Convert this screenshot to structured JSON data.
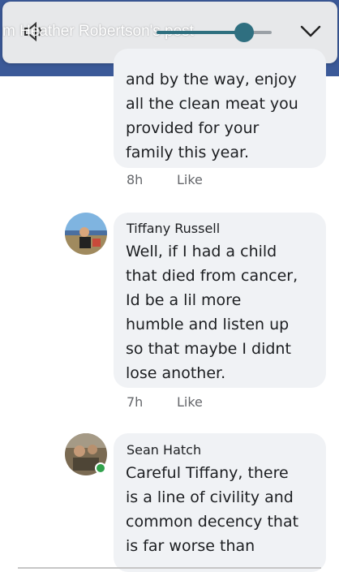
{
  "header": {
    "post_title": "m Heather Robertson's post",
    "volume_level": 0.73
  },
  "comments": [
    {
      "text": "and by the way, enjoy\nall the clean meat you\nprovided for your\nfamily this year.",
      "time": "8h",
      "like_label": "Like"
    },
    {
      "author": "Tiffany Russell",
      "text": "Well, if I had a child\nthat died from cancer,\nId be a lil more\nhumble and listen up\nso that maybe I didnt\nlose another.",
      "time": "7h",
      "like_label": "Like"
    },
    {
      "author": "Sean Hatch",
      "text": "Careful Tiffany, there\nis a line of civility and\ncommon decency that\nis far worse than",
      "online": true
    }
  ],
  "colors": {
    "fb_blue": "#3b5998",
    "bubble_bg": "#f0f2f5",
    "volume_accent": "#2f6f80",
    "online_green": "#31a24c"
  }
}
